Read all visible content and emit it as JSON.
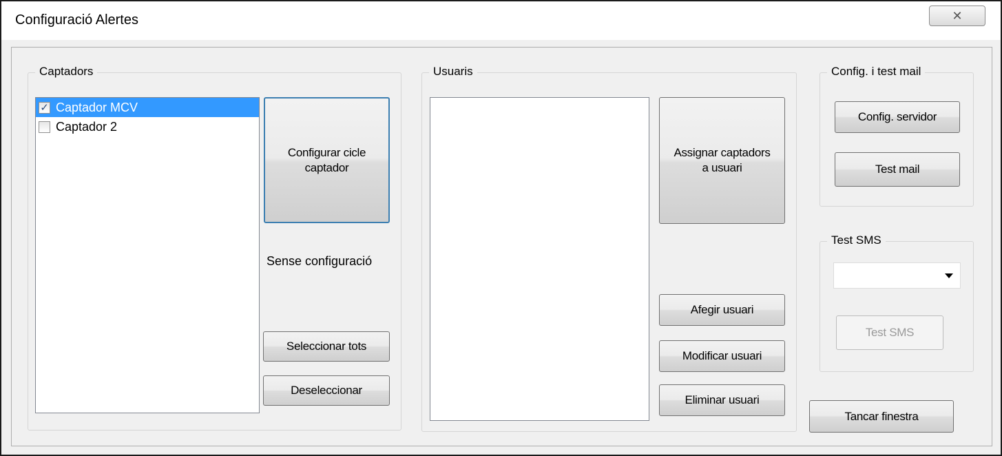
{
  "window": {
    "title": "Configuració Alertes",
    "close_glyph": "✕",
    "close_icon": "close-icon"
  },
  "captadors": {
    "group_label": "Captadors",
    "items": [
      {
        "label": "Captador MCV",
        "checked": true,
        "selected": true
      },
      {
        "label": "Captador 2",
        "checked": false,
        "selected": false
      }
    ],
    "configure_button": "Configurar cicle captador",
    "status_text": "Sense configuració",
    "select_all_button": "Seleccionar tots",
    "deselect_button": "Deseleccionar"
  },
  "usuaris": {
    "group_label": "Usuaris",
    "assign_button": "Assignar captadors a usuari",
    "add_button": "Afegir usuari",
    "modify_button": "Modificar usuari",
    "delete_button": "Eliminar usuari"
  },
  "mail": {
    "group_label": "Config. i test mail",
    "server_button": "Config. servidor",
    "test_button": "Test mail"
  },
  "sms": {
    "group_label": "Test SMS",
    "dropdown_value": "",
    "test_button": "Test SMS",
    "test_button_disabled": true
  },
  "close_window_button": "Tancar finestra",
  "colors": {
    "selection": "#3399ff",
    "focus_border": "#3c7fb1"
  }
}
